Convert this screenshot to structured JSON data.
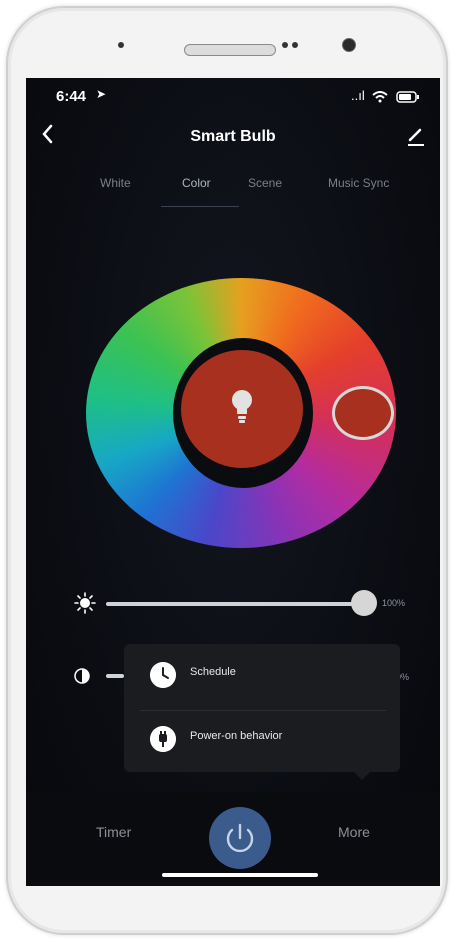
{
  "status_bar": {
    "time": "6:44",
    "signal": "..ıl",
    "wifi": "wifi-icon",
    "battery": "battery-icon"
  },
  "nav": {
    "title": "Smart Bulb",
    "back_icon": "chevron-left-icon",
    "edit_icon": "pencil-icon"
  },
  "tabs": [
    {
      "label": "White",
      "active": false
    },
    {
      "label": "Color",
      "active": true
    },
    {
      "label": "Scene",
      "active": false
    },
    {
      "label": "Music Sync",
      "active": false
    }
  ],
  "color": {
    "selected_hex": "#a8301f"
  },
  "brightness": {
    "icon": "sun-icon",
    "value": "100%",
    "level": 1.0
  },
  "contrast": {
    "icon": "contrast-icon",
    "value": "0%"
  },
  "more_menu": {
    "items": [
      {
        "label": "Schedule",
        "icon": "clock-icon"
      },
      {
        "label": "Power-on behavior",
        "icon": "plug-icon"
      }
    ]
  },
  "bottom": {
    "timer_label": "Timer",
    "more_label": "More",
    "power_icon": "power-icon"
  },
  "colors": {
    "accent": "#3a5b8c",
    "background": "#0b0d13",
    "popup": "#1b1c20"
  }
}
